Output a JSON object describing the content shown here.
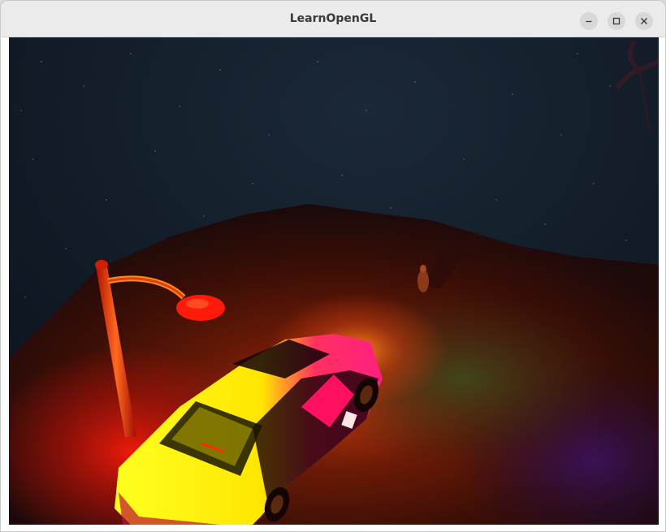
{
  "window": {
    "title": "LearnOpenGL"
  },
  "controls": {
    "minimize_icon": "minimize-icon",
    "maximize_icon": "maximize-icon",
    "close_icon": "close-icon"
  },
  "scene": {
    "sky_color": "#0f1b28",
    "ground_color": "#5a1508",
    "light_color": "#ff3a1a",
    "car_color": "#ffff00",
    "lamp_color": "#ff2200"
  }
}
